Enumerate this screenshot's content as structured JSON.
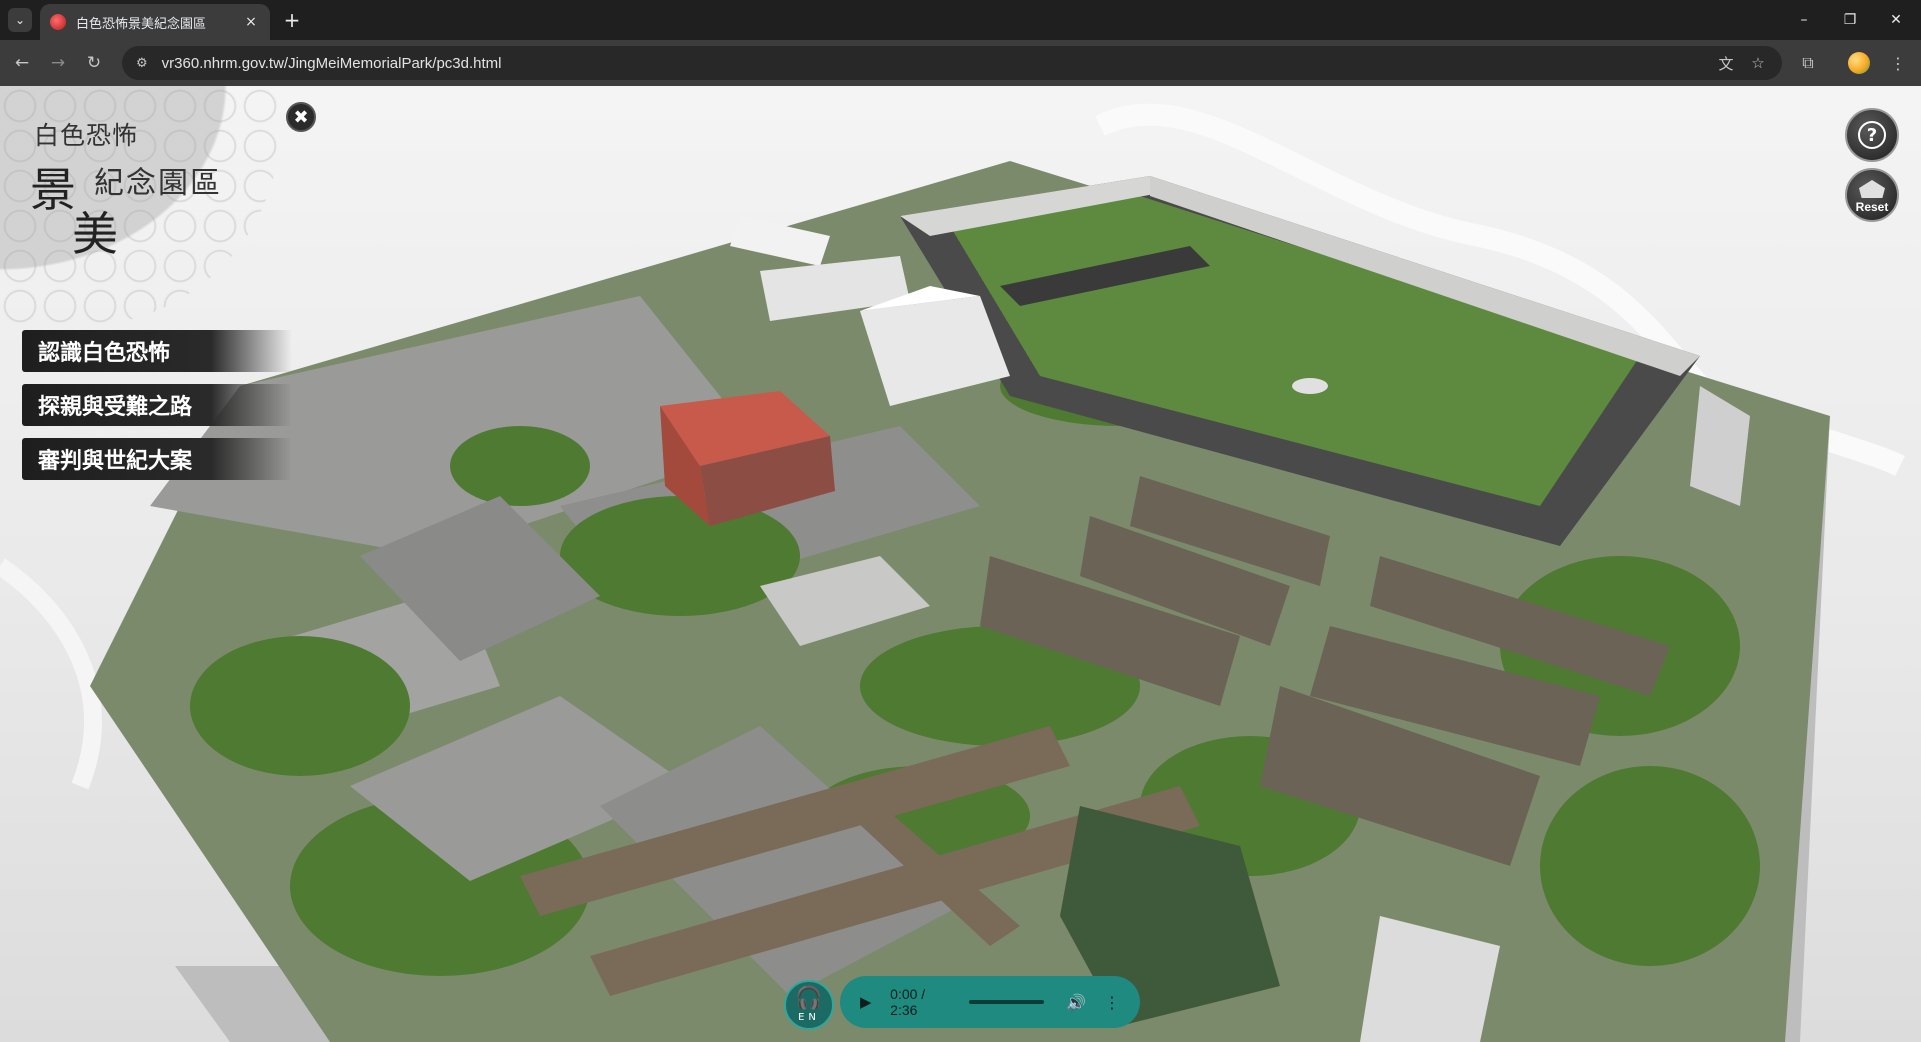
{
  "browser": {
    "tab_title": "白色恐怖景美紀念園區",
    "tab_close": "×",
    "new_tab": "+",
    "url": "vr360.nhrm.gov.tw/JingMeiMemorialPark/pc3d.html",
    "window_controls": {
      "minimize": "–",
      "restore": "❐",
      "close": "✕"
    }
  },
  "logo": {
    "line1": "白色恐怖",
    "big_char1": "景",
    "big_char2": "美",
    "line2": "紀念園區"
  },
  "menu": {
    "items": [
      {
        "label": "認識白色恐怖"
      },
      {
        "label": "探親與受難之路"
      },
      {
        "label": "審判與世紀大案"
      }
    ]
  },
  "controls": {
    "help_symbol": "?",
    "reset_label": "Reset",
    "close_symbol": "✖"
  },
  "audio": {
    "language_label": "EN",
    "time": "0:00 / 2:36",
    "progress": 0
  },
  "colors": {
    "audio_accent": "#1f8a80",
    "menu_bg": "#1e1e1e",
    "grass": "#4e7a32",
    "roof_red": "#c85a4c"
  }
}
